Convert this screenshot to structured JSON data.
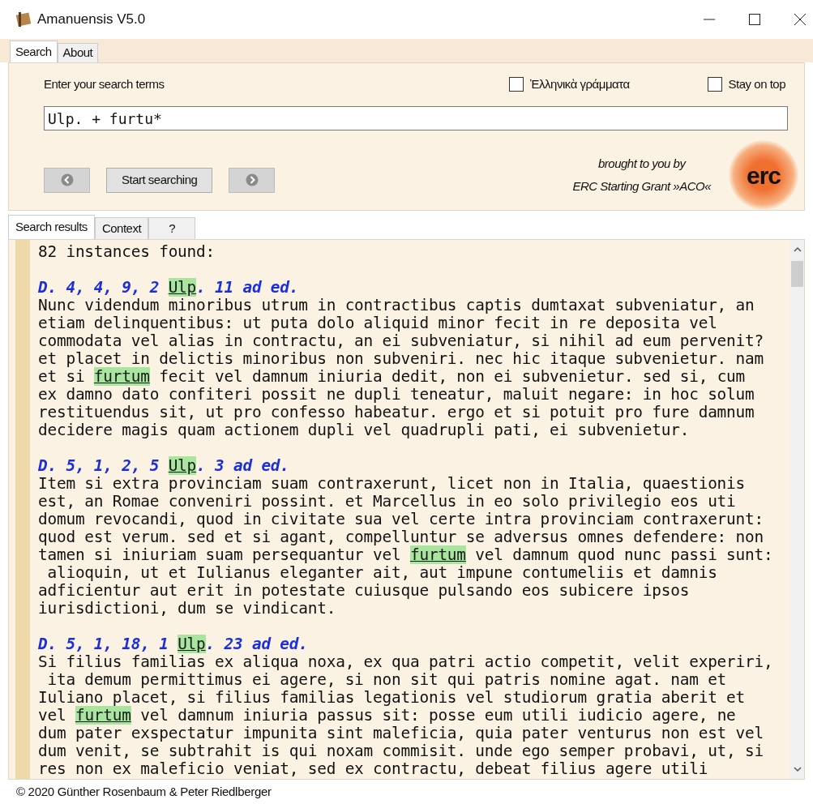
{
  "window": {
    "title": "Amanuensis V5.0"
  },
  "top_tabs": [
    {
      "label": "Search",
      "selected": true
    },
    {
      "label": "About",
      "selected": false
    }
  ],
  "search": {
    "label": "Enter your search terms",
    "value": "Ulp. + furtu*",
    "options": [
      {
        "label": "Ἑλληνικὰ γράμματα",
        "checked": false
      },
      {
        "label": "Stay on top",
        "checked": false
      }
    ],
    "start_button": "Start searching"
  },
  "credit": {
    "line_1": "brought to you by",
    "line_2": "ERC Starting Grant »ACO«",
    "logo": "erc"
  },
  "result_tabs": [
    {
      "label": "Search results",
      "selected": true
    },
    {
      "label": "Context",
      "selected": false
    },
    {
      "label": "?",
      "selected": false
    }
  ],
  "results": {
    "summary": "82 instances found:",
    "entries": [
      {
        "heading": [
          {
            "text": "D. 4, 4, 9, 2 ",
            "highlighted": false
          },
          {
            "text": "Ulp",
            "highlighted": true
          },
          {
            "text": ". 11 ad ed.",
            "highlighted": false
          }
        ],
        "lines": [
          [
            {
              "text": "Nunc videndum minoribus utrum in contractibus captis dumtaxat subveniatur, an",
              "highlighted": false
            }
          ],
          [
            {
              "text": "etiam delinquentibus: ut puta dolo aliquid minor fecit in re deposita vel",
              "highlighted": false
            }
          ],
          [
            {
              "text": "commodata vel alias in contractu, an ei subveniatur, si nihil ad eum pervenit?",
              "highlighted": false
            }
          ],
          [
            {
              "text": "et placet in delictis minoribus non subveniri. nec hic itaque subvenietur. nam",
              "highlighted": false
            }
          ],
          [
            {
              "text": "et si ",
              "highlighted": false
            },
            {
              "text": "furtum",
              "highlighted": true
            },
            {
              "text": " fecit vel damnum iniuria dedit, non ei subvenietur. sed si, cum",
              "highlighted": false
            }
          ],
          [
            {
              "text": "ex damno dato confiteri possit ne dupli teneatur, maluit negare: in hoc solum",
              "highlighted": false
            }
          ],
          [
            {
              "text": "restituendus sit, ut pro confesso habeatur. ergo et si potuit pro fure damnum",
              "highlighted": false
            }
          ],
          [
            {
              "text": "decidere magis quam actionem dupli vel quadrupli pati, ei subvenietur.",
              "highlighted": false
            }
          ]
        ]
      },
      {
        "heading": [
          {
            "text": "D. 5, 1, 2, 5 ",
            "highlighted": false
          },
          {
            "text": "Ulp",
            "highlighted": true
          },
          {
            "text": ". 3 ad ed.",
            "highlighted": false
          }
        ],
        "lines": [
          [
            {
              "text": "Item si extra provinciam suam contraxerunt, licet non in Italia, quaestionis",
              "highlighted": false
            }
          ],
          [
            {
              "text": "est, an Romae conveniri possint. et Marcellus in eo solo privilegio eos uti",
              "highlighted": false
            }
          ],
          [
            {
              "text": "domum revocandi, quod in civitate sua vel certe intra provinciam contraxerunt:",
              "highlighted": false
            }
          ],
          [
            {
              "text": "quod est verum. sed et si agant, compelluntur se adversus omnes defendere: non",
              "highlighted": false
            }
          ],
          [
            {
              "text": "tamen si iniuriam suam persequantur vel ",
              "highlighted": false
            },
            {
              "text": "furtum",
              "highlighted": true
            },
            {
              "text": " vel damnum quod nunc passi sunt:",
              "highlighted": false
            }
          ],
          [
            {
              "text": " alioquin, ut et Iulianus eleganter ait, aut impune contumeliis et damnis",
              "highlighted": false
            }
          ],
          [
            {
              "text": "adficientur aut erit in potestate cuiusque pulsando eos subicere ipsos",
              "highlighted": false
            }
          ],
          [
            {
              "text": "iurisdictioni, dum se vindicant.",
              "highlighted": false
            }
          ]
        ]
      },
      {
        "heading": [
          {
            "text": "D. 5, 1, 18, 1 ",
            "highlighted": false
          },
          {
            "text": "Ulp",
            "highlighted": true
          },
          {
            "text": ". 23 ad ed.",
            "highlighted": false
          }
        ],
        "lines": [
          [
            {
              "text": "Si filius familias ex aliqua noxa, ex qua patri actio competit, velit experiri,",
              "highlighted": false
            }
          ],
          [
            {
              "text": " ita demum permittimus ei agere, si non sit qui patris nomine agat. nam et",
              "highlighted": false
            }
          ],
          [
            {
              "text": "Iuliano placet, si filius familias legationis vel studiorum gratia aberit et",
              "highlighted": false
            }
          ],
          [
            {
              "text": "vel ",
              "highlighted": false
            },
            {
              "text": "furtum",
              "highlighted": true
            },
            {
              "text": " vel damnum iniuria passus sit: posse eum utili iudicio agere, ne",
              "highlighted": false
            }
          ],
          [
            {
              "text": "dum pater exspectatur impunita sint maleficia, quia pater venturus non est vel",
              "highlighted": false
            }
          ],
          [
            {
              "text": "dum venit, se subtrahit is qui noxam commisit. unde ego semper probavi, ut, si",
              "highlighted": false
            }
          ],
          [
            {
              "text": "res non ex maleficio veniat, sed ex contractu, debeat filius agere utili",
              "highlighted": false
            }
          ]
        ]
      }
    ]
  },
  "status_bar": "© 2020 Günther Rosenbaum & Peter Riedlberger"
}
